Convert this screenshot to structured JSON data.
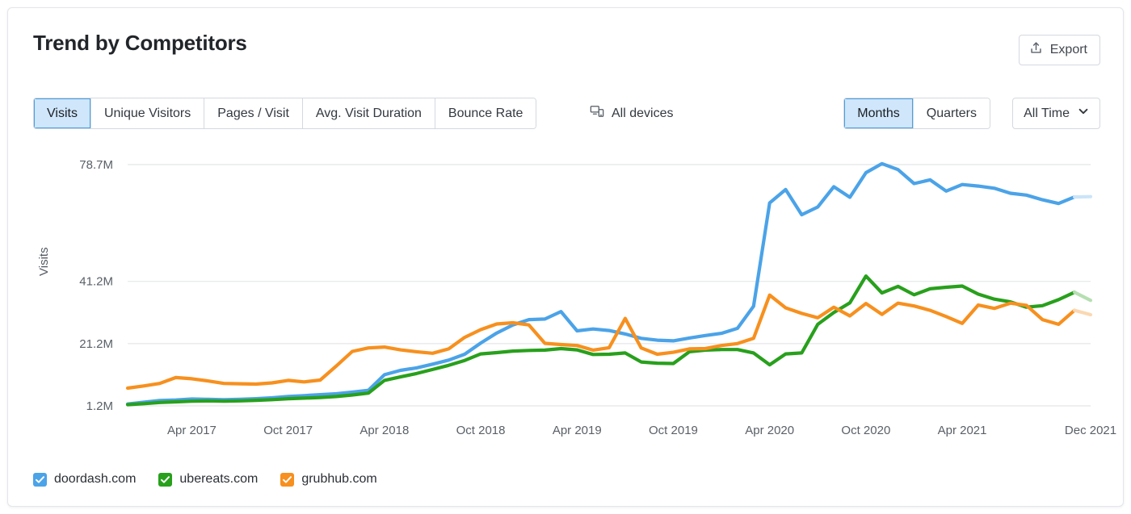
{
  "header": {
    "title": "Trend by Competitors",
    "export_label": "Export",
    "export_icon": "upload-icon"
  },
  "toolbar": {
    "metrics": [
      {
        "label": "Visits",
        "active": true
      },
      {
        "label": "Unique Visitors",
        "active": false
      },
      {
        "label": "Pages / Visit",
        "active": false
      },
      {
        "label": "Avg. Visit Duration",
        "active": false
      },
      {
        "label": "Bounce Rate",
        "active": false
      }
    ],
    "devices_label": "All devices",
    "devices_icon": "devices-icon",
    "granularity": [
      {
        "label": "Months",
        "active": true
      },
      {
        "label": "Quarters",
        "active": false
      }
    ],
    "time_range_label": "All Time",
    "time_range_icon": "chevron-down-icon"
  },
  "legend": {
    "items": [
      {
        "label": "doordash.com",
        "color": "#4ba3e8",
        "checked": true
      },
      {
        "label": "ubereats.com",
        "color": "#28a01c",
        "checked": true
      },
      {
        "label": "grubhub.com",
        "color": "#f7901e",
        "checked": true
      }
    ]
  },
  "colors": {
    "doordash": "#4ba3e8",
    "ubereats": "#28a01c",
    "grubhub": "#f7901e",
    "doordash_faded": "#cbe4f8",
    "ubereats_faded": "#b6dfb1",
    "grubhub_faded": "#fbd8b2",
    "grid": "#e8eaec",
    "axis_text": "#5a6067",
    "accent": "#4a9fe0",
    "tab_active_bg": "#cfe6fb"
  },
  "chart_data": {
    "type": "line",
    "title": "Trend by Competitors",
    "xlabel": "",
    "ylabel": "Visits",
    "ylim": [
      1200000,
      78700000
    ],
    "ytick_labels": [
      "78.7M",
      "41.2M",
      "21.2M",
      "1.2M"
    ],
    "ytick_values": [
      78700000,
      41200000,
      21200000,
      1200000
    ],
    "grid": true,
    "legend_position": "bottom-left",
    "forecast_last_segment": true,
    "xtick_labels": [
      "Apr 2017",
      "Oct 2017",
      "Apr 2018",
      "Oct 2018",
      "Apr 2019",
      "Oct 2019",
      "Apr 2020",
      "Oct 2020",
      "Apr 2021",
      "Dec 2021"
    ],
    "x": [
      "Dec 2016",
      "Jan 2017",
      "Feb 2017",
      "Mar 2017",
      "Apr 2017",
      "May 2017",
      "Jun 2017",
      "Jul 2017",
      "Aug 2017",
      "Sep 2017",
      "Oct 2017",
      "Nov 2017",
      "Dec 2017",
      "Jan 2018",
      "Feb 2018",
      "Mar 2018",
      "Apr 2018",
      "May 2018",
      "Jun 2018",
      "Jul 2018",
      "Aug 2018",
      "Sep 2018",
      "Oct 2018",
      "Nov 2018",
      "Dec 2018",
      "Jan 2019",
      "Feb 2019",
      "Mar 2019",
      "Apr 2019",
      "May 2019",
      "Jun 2019",
      "Jul 2019",
      "Aug 2019",
      "Sep 2019",
      "Oct 2019",
      "Nov 2019",
      "Dec 2019",
      "Jan 2020",
      "Feb 2020",
      "Mar 2020",
      "Apr 2020",
      "May 2020",
      "Jun 2020",
      "Jul 2020",
      "Aug 2020",
      "Sep 2020",
      "Oct 2020",
      "Nov 2020",
      "Dec 2020",
      "Jan 2021",
      "Feb 2021",
      "Mar 2021",
      "Apr 2021",
      "May 2021",
      "Jun 2021",
      "Jul 2021",
      "Aug 2021",
      "Sep 2021",
      "Oct 2021",
      "Nov 2021",
      "Dec 2021"
    ],
    "series": [
      {
        "name": "doordash.com",
        "color": "#4ba3e8",
        "values": [
          1800000,
          2400000,
          2900000,
          3100000,
          3400000,
          3300000,
          3200000,
          3300000,
          3500000,
          3800000,
          4200000,
          4500000,
          4800000,
          5100000,
          5600000,
          6200000,
          11200000,
          12600000,
          13400000,
          14600000,
          15900000,
          17800000,
          21400000,
          24600000,
          27200000,
          28900000,
          29100000,
          31500000,
          25300000,
          25900000,
          25400000,
          24300000,
          22900000,
          22300000,
          22100000,
          23000000,
          23800000,
          24500000,
          26100000,
          33200000,
          66400000,
          70700000,
          62600000,
          65100000,
          71600000,
          68200000,
          76100000,
          79000000,
          77100000,
          72600000,
          73800000,
          70200000,
          72300000,
          71800000,
          71100000,
          69500000,
          68900000,
          67400000,
          66200000,
          68300000,
          68400000
        ]
      },
      {
        "name": "ubereats.com",
        "color": "#28a01c",
        "values": [
          1600000,
          1900000,
          2300000,
          2500000,
          2700000,
          2800000,
          2700000,
          2800000,
          3000000,
          3200000,
          3500000,
          3700000,
          3900000,
          4200000,
          4700000,
          5300000,
          9400000,
          10500000,
          11600000,
          12900000,
          14200000,
          15800000,
          17900000,
          18300000,
          18800000,
          19000000,
          19100000,
          19600000,
          19200000,
          17700000,
          17800000,
          18200000,
          15300000,
          14900000,
          14800000,
          18600000,
          19100000,
          19300000,
          19300000,
          18200000,
          14400000,
          17900000,
          18200000,
          27400000,
          31200000,
          34300000,
          42900000,
          37500000,
          39600000,
          36900000,
          38800000,
          39300000,
          39700000,
          37100000,
          35500000,
          34600000,
          32900000,
          33400000,
          35300000,
          37700000,
          35100000
        ]
      },
      {
        "name": "grubhub.com",
        "color": "#f7901e",
        "values": [
          6900000,
          7600000,
          8400000,
          10300000,
          9900000,
          9200000,
          8400000,
          8300000,
          8200000,
          8600000,
          9400000,
          8900000,
          9500000,
          14000000,
          18700000,
          19800000,
          20100000,
          19200000,
          18600000,
          18100000,
          19500000,
          23200000,
          25700000,
          27500000,
          27900000,
          27200000,
          21300000,
          20900000,
          20600000,
          19100000,
          19900000,
          29300000,
          19800000,
          17800000,
          18400000,
          19500000,
          19600000,
          20600000,
          21200000,
          22900000,
          36800000,
          32700000,
          30900000,
          29500000,
          32900000,
          30100000,
          34100000,
          30600000,
          34200000,
          33300000,
          31900000,
          29900000,
          27700000,
          33600000,
          32500000,
          34200000,
          33500000,
          28900000,
          27400000,
          31900000,
          30500000
        ]
      }
    ]
  }
}
